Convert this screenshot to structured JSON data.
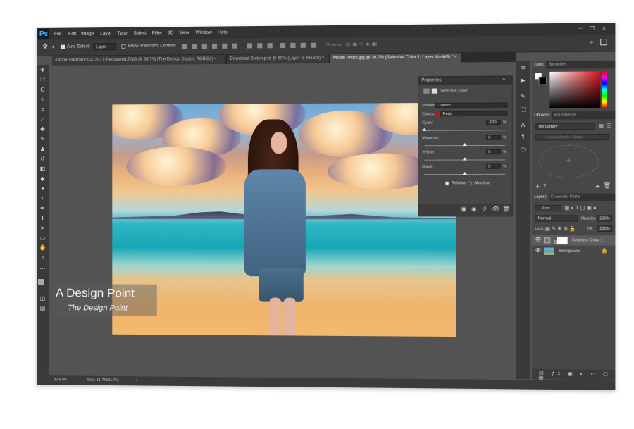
{
  "app": {
    "logo": "Ps"
  },
  "menu": [
    "File",
    "Edit",
    "Image",
    "Layer",
    "Type",
    "Select",
    "Filter",
    "3D",
    "View",
    "Window",
    "Help"
  ],
  "options": {
    "auto_select_label": "Auto-Select:",
    "auto_select_value": "Layer",
    "transform_label": "Show Transform Controls",
    "mode_3d": "3D Mode:"
  },
  "tabs": [
    {
      "label": "Adobe-Illustrator-CC-2017-Recovered.PNG @ 66.7% (The Design Doctor, RGB/8#) ×"
    },
    {
      "label": "Download Button.psd @ 50% (Layer 2, RGB/8) ×"
    },
    {
      "label": "Model Photo.jpg @ 36.7% (Selective Color 1, Layer Mask/8) *  ×"
    }
  ],
  "watermark": {
    "line1": "A Design Point",
    "line2": "The Design Point"
  },
  "properties": {
    "title": "Properties",
    "subtitle": "Selective Color",
    "preset_label": "Preset:",
    "preset_value": "Custom",
    "colors_label": "Colors:",
    "colors_value": "Reds",
    "cyan_label": "Cyan:",
    "cyan_value": "-100",
    "magenta_label": "Magenta:",
    "magenta_value": "0",
    "yellow_label": "Yellow:",
    "yellow_value": "0",
    "black_label": "Black:",
    "black_value": "0",
    "pct": "%",
    "relative": "Relative",
    "absolute": "Absolute",
    "levels": {
      "cyan": 0,
      "magenta": 0.5,
      "yellow": 0.5,
      "black": 0.5
    }
  },
  "color_panel": {
    "tabs": [
      "Color",
      "Swatches"
    ]
  },
  "libraries_panel": {
    "tabs": [
      "Libraries",
      "Adjustments"
    ],
    "library": "My Library",
    "search_placeholder": "Search Adobe Stock"
  },
  "layers_panel": {
    "tabs": [
      "Layers",
      "Channels",
      "Paths"
    ],
    "kind": "Kind",
    "blend": "Normal",
    "opacity_label": "Opacity:",
    "opacity_value": "100%",
    "lock_label": "Lock:",
    "fill_label": "Fill:",
    "fill_value": "100%",
    "layers": [
      {
        "name": "Selective Color 1"
      },
      {
        "name": "Background"
      }
    ]
  },
  "status": {
    "zoom": "36.67%",
    "doc": "Doc: 11.7M/11.7M"
  },
  "colors": {
    "accent_red": "#e0101a",
    "ps_blue": "#4ab0ff"
  }
}
